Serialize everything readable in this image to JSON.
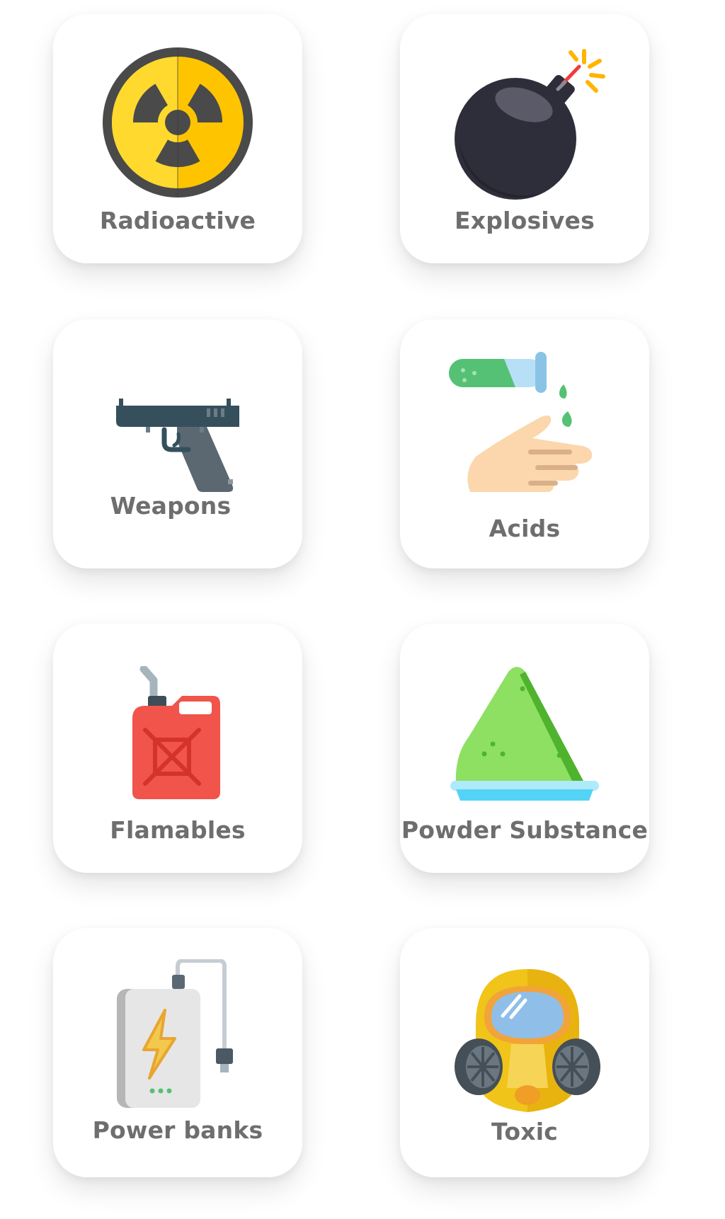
{
  "categories": [
    {
      "label": "Radioactive",
      "icon": "radioactive-icon"
    },
    {
      "label": "Explosives",
      "icon": "bomb-icon"
    },
    {
      "label": "Weapons",
      "icon": "gun-icon"
    },
    {
      "label": "Acids",
      "icon": "acid-icon"
    },
    {
      "label": "Flamables",
      "icon": "fuel-canister-icon"
    },
    {
      "label": "Powder Substance",
      "icon": "powder-pile-icon"
    },
    {
      "label": "Power banks",
      "icon": "power-bank-icon"
    },
    {
      "label": "Toxic",
      "icon": "gas-mask-icon"
    }
  ],
  "colors": {
    "label_text": "#6e6e6e",
    "card_background": "#ffffff",
    "radioactive_yellow": "#ffc400",
    "bomb_dark": "#2e2e3a",
    "gun_gray": "#5b6872",
    "acid_green": "#55c174",
    "canister_red": "#f0544a",
    "powder_green": "#8ee063",
    "tray_blue": "#55d3f7",
    "powerbank_gray": "#e6e6e6",
    "mask_yellow": "#f0c419"
  }
}
